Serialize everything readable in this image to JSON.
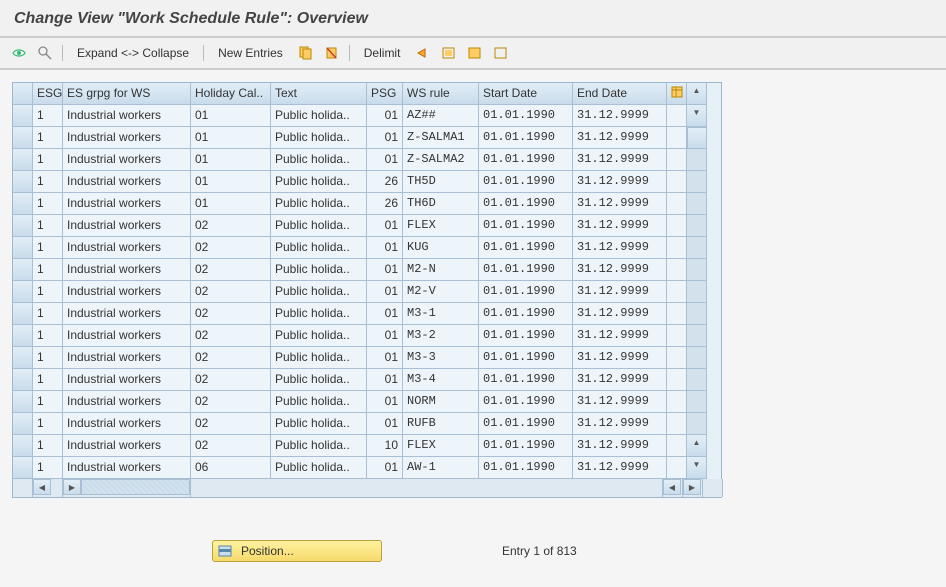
{
  "title": "Change View \"Work Schedule Rule\": Overview",
  "toolbar": {
    "expand": "Expand <-> Collapse",
    "new_entries": "New Entries",
    "delimit": "Delimit"
  },
  "columns": {
    "esg": "ESG",
    "esgrp": "ES grpg for WS",
    "hcal": "Holiday Cal..",
    "text": "Text",
    "psg": "PSG",
    "wsrule": "WS rule",
    "sdate": "Start Date",
    "edate": "End Date"
  },
  "rows": [
    {
      "esg": "1",
      "esgrp": "Industrial workers",
      "hcal": "01",
      "text": "Public holida..",
      "psg": "01",
      "wsrule": "AZ##",
      "sdate": "01.01.1990",
      "edate": "31.12.9999"
    },
    {
      "esg": "1",
      "esgrp": "Industrial workers",
      "hcal": "01",
      "text": "Public holida..",
      "psg": "01",
      "wsrule": "Z-SALMA1",
      "sdate": "01.01.1990",
      "edate": "31.12.9999"
    },
    {
      "esg": "1",
      "esgrp": "Industrial workers",
      "hcal": "01",
      "text": "Public holida..",
      "psg": "01",
      "wsrule": "Z-SALMA2",
      "sdate": "01.01.1990",
      "edate": "31.12.9999"
    },
    {
      "esg": "1",
      "esgrp": "Industrial workers",
      "hcal": "01",
      "text": "Public holida..",
      "psg": "26",
      "wsrule": "TH5D",
      "sdate": "01.01.1990",
      "edate": "31.12.9999"
    },
    {
      "esg": "1",
      "esgrp": "Industrial workers",
      "hcal": "01",
      "text": "Public holida..",
      "psg": "26",
      "wsrule": "TH6D",
      "sdate": "01.01.1990",
      "edate": "31.12.9999"
    },
    {
      "esg": "1",
      "esgrp": "Industrial workers",
      "hcal": "02",
      "text": "Public holida..",
      "psg": "01",
      "wsrule": "FLEX",
      "sdate": "01.01.1990",
      "edate": "31.12.9999"
    },
    {
      "esg": "1",
      "esgrp": "Industrial workers",
      "hcal": "02",
      "text": "Public holida..",
      "psg": "01",
      "wsrule": "KUG",
      "sdate": "01.01.1990",
      "edate": "31.12.9999"
    },
    {
      "esg": "1",
      "esgrp": "Industrial workers",
      "hcal": "02",
      "text": "Public holida..",
      "psg": "01",
      "wsrule": "M2-N",
      "sdate": "01.01.1990",
      "edate": "31.12.9999"
    },
    {
      "esg": "1",
      "esgrp": "Industrial workers",
      "hcal": "02",
      "text": "Public holida..",
      "psg": "01",
      "wsrule": "M2-V",
      "sdate": "01.01.1990",
      "edate": "31.12.9999"
    },
    {
      "esg": "1",
      "esgrp": "Industrial workers",
      "hcal": "02",
      "text": "Public holida..",
      "psg": "01",
      "wsrule": "M3-1",
      "sdate": "01.01.1990",
      "edate": "31.12.9999"
    },
    {
      "esg": "1",
      "esgrp": "Industrial workers",
      "hcal": "02",
      "text": "Public holida..",
      "psg": "01",
      "wsrule": "M3-2",
      "sdate": "01.01.1990",
      "edate": "31.12.9999"
    },
    {
      "esg": "1",
      "esgrp": "Industrial workers",
      "hcal": "02",
      "text": "Public holida..",
      "psg": "01",
      "wsrule": "M3-3",
      "sdate": "01.01.1990",
      "edate": "31.12.9999"
    },
    {
      "esg": "1",
      "esgrp": "Industrial workers",
      "hcal": "02",
      "text": "Public holida..",
      "psg": "01",
      "wsrule": "M3-4",
      "sdate": "01.01.1990",
      "edate": "31.12.9999"
    },
    {
      "esg": "1",
      "esgrp": "Industrial workers",
      "hcal": "02",
      "text": "Public holida..",
      "psg": "01",
      "wsrule": "NORM",
      "sdate": "01.01.1990",
      "edate": "31.12.9999"
    },
    {
      "esg": "1",
      "esgrp": "Industrial workers",
      "hcal": "02",
      "text": "Public holida..",
      "psg": "01",
      "wsrule": "RUFB",
      "sdate": "01.01.1990",
      "edate": "31.12.9999"
    },
    {
      "esg": "1",
      "esgrp": "Industrial workers",
      "hcal": "02",
      "text": "Public holida..",
      "psg": "10",
      "wsrule": "FLEX",
      "sdate": "01.01.1990",
      "edate": "31.12.9999"
    },
    {
      "esg": "1",
      "esgrp": "Industrial workers",
      "hcal": "06",
      "text": "Public holida..",
      "psg": "01",
      "wsrule": "AW-1",
      "sdate": "01.01.1990",
      "edate": "31.12.9999"
    }
  ],
  "footer": {
    "position": "Position...",
    "entry": "Entry 1 of 813"
  }
}
